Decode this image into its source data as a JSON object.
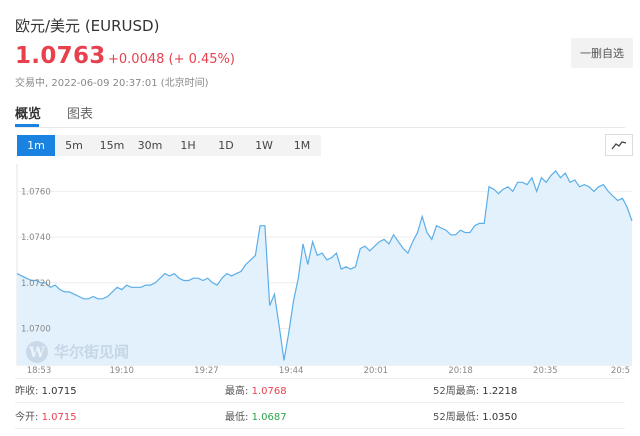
{
  "header": {
    "title": "欧元/美元  (EURUSD)",
    "price": "1.0763",
    "change": "+0.0048 (+ 0.45%)",
    "status": "交易中,  2022-06-09 20:37:01 (北京时间)",
    "watch_button": "一删自选"
  },
  "tabs": [
    "概览",
    "图表"
  ],
  "periods": [
    "1m",
    "5m",
    "15m",
    "30m",
    "1H",
    "1D",
    "1W",
    "1M"
  ],
  "active_period": "1m",
  "watermark": "华尔街见闻",
  "colors": {
    "up": "#e8414e",
    "down": "#2aa34a",
    "accent": "#1a82e0",
    "line": "#5aaee8",
    "area": "#e3f1fc"
  },
  "chart_data": {
    "type": "area",
    "x_tick_labels": [
      "18:53",
      "19:10",
      "19:27",
      "19:44",
      "20:01",
      "20:18",
      "20:35",
      "20:5"
    ],
    "y_tick_labels": [
      "1.0700",
      "1.0720",
      "1.0740",
      "1.0760"
    ],
    "ylim": [
      1.0684,
      1.0772
    ],
    "grid": true,
    "series": [
      {
        "values": [
          1.0724,
          1.0723,
          1.0722,
          1.0721,
          1.0721,
          1.072,
          1.072,
          1.0718,
          1.0719,
          1.0717,
          1.0716,
          1.0716,
          1.0715,
          1.0714,
          1.0713,
          1.0713,
          1.0714,
          1.0713,
          1.0713,
          1.0714,
          1.0716,
          1.0718,
          1.0717,
          1.0719,
          1.0718,
          1.0718,
          1.0718,
          1.0719,
          1.0719,
          1.072,
          1.0722,
          1.0724,
          1.0723,
          1.0724,
          1.0722,
          1.0721,
          1.0721,
          1.0722,
          1.0722,
          1.0721,
          1.0722,
          1.072,
          1.0719,
          1.0722,
          1.0724,
          1.0723,
          1.0724,
          1.0725,
          1.0728,
          1.073,
          1.0732,
          1.0745,
          1.0745,
          1.071,
          1.0715,
          1.0701,
          1.0686,
          1.0698,
          1.0712,
          1.0722,
          1.0737,
          1.0728,
          1.0738,
          1.0732,
          1.0733,
          1.073,
          1.0731,
          1.0733,
          1.0726,
          1.0727,
          1.0726,
          1.0727,
          1.0735,
          1.0736,
          1.0734,
          1.0736,
          1.0738,
          1.0739,
          1.0737,
          1.0741,
          1.0738,
          1.0735,
          1.0733,
          1.0738,
          1.0742,
          1.0749,
          1.0742,
          1.0739,
          1.0745,
          1.0744,
          1.0743,
          1.0741,
          1.0741,
          1.0743,
          1.0742,
          1.0742,
          1.0745,
          1.0746,
          1.0746,
          1.0762,
          1.0761,
          1.0759,
          1.0761,
          1.0762,
          1.076,
          1.0764,
          1.0764,
          1.0763,
          1.0766,
          1.076,
          1.0766,
          1.0764,
          1.0767,
          1.0769,
          1.0766,
          1.0768,
          1.0764,
          1.0765,
          1.0762,
          1.0763,
          1.0762,
          1.076,
          1.0762,
          1.0763,
          1.076,
          1.0758,
          1.0756,
          1.0757,
          1.0753,
          1.0747
        ]
      }
    ]
  },
  "stats": [
    [
      {
        "label": "昨收:",
        "value": "1.0715",
        "tone": "flat"
      },
      {
        "label": "最高:",
        "value": "1.0768",
        "tone": "up"
      },
      {
        "label": "52周最高:",
        "value": "1.2218",
        "tone": "flat"
      }
    ],
    [
      {
        "label": "今开:",
        "value": "1.0715",
        "tone": "up"
      },
      {
        "label": "最低:",
        "value": "1.0687",
        "tone": "down"
      },
      {
        "label": "52周最低:",
        "value": "1.0350",
        "tone": "flat"
      }
    ]
  ]
}
